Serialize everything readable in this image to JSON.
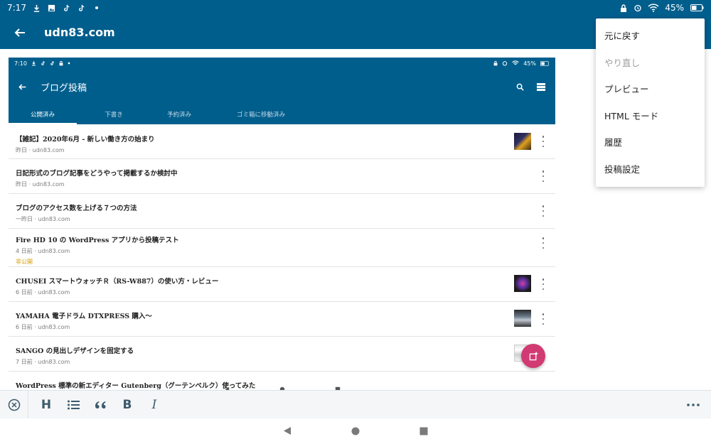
{
  "status_bar": {
    "time": "7:17",
    "battery": "45%"
  },
  "app_bar": {
    "title": "udn83.com"
  },
  "menu": {
    "items": [
      {
        "label": "元に戻す",
        "enabled": true
      },
      {
        "label": "やり直し",
        "enabled": false
      },
      {
        "label": "プレビュー",
        "enabled": true
      },
      {
        "label": "HTML モード",
        "enabled": true
      },
      {
        "label": "履歴",
        "enabled": true
      },
      {
        "label": "投稿設定",
        "enabled": true
      }
    ]
  },
  "embedded": {
    "status_bar": {
      "time": "7:10",
      "battery": "45%"
    },
    "app_bar": {
      "title": "ブログ投稿"
    },
    "tabs": [
      "公開済み",
      "下書き",
      "予約済み",
      "ゴミ箱に移動済み"
    ],
    "posts": [
      {
        "title": "【雑記】2020年6月 - 新しい働き方の始まり",
        "date": "昨日",
        "site": "udn83.com"
      },
      {
        "title": "日記形式のブログ記事をどうやって掲載するか検討中",
        "date": "昨日",
        "site": "udn83.com"
      },
      {
        "title": "ブログのアクセス数を上げる７つの方法",
        "date": "一昨日",
        "site": "udn83.com"
      },
      {
        "title": "Fire HD 10 の WordPress アプリから投稿テスト",
        "date": "4 日前",
        "site": "udn83.com",
        "status": "非公開"
      },
      {
        "title": "CHUSEI スマートウォッチＲ（RS-W887）の使い方・レビュー",
        "date": "6 日前",
        "site": "udn83.com"
      },
      {
        "title": "YAMAHA 電子ドラム DTXPRESS 購入～",
        "date": "6 日前",
        "site": "udn83.com"
      },
      {
        "title": "SANGO の見出しデザインを固定する",
        "date": "7 日前",
        "site": "udn83.com"
      },
      {
        "title": "WordPress 標準の新エディター Gutenberg（グーテンベルク）使ってみた",
        "date": "",
        "site": ""
      }
    ],
    "meta_separator": "·"
  },
  "toolbar": {
    "heading": "H",
    "bold": "B",
    "italic": "I"
  },
  "colors": {
    "primary": "#005e8d",
    "fab": "#d13a73",
    "private": "#d89a00"
  }
}
